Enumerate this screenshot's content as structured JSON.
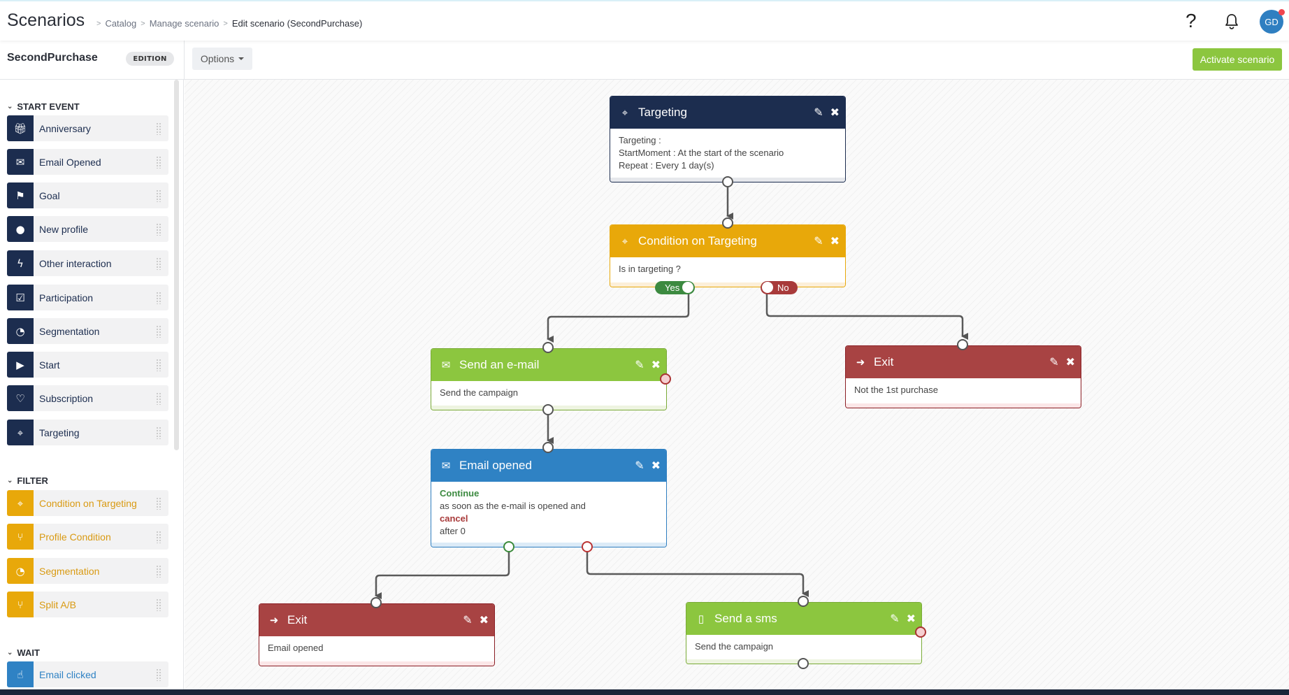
{
  "header": {
    "app_title": "Scenarios",
    "breadcrumb": [
      "Catalog",
      "Manage scenario",
      "Edit scenario (SecondPurchase)"
    ],
    "help_label": "?",
    "avatar_initials": "GD"
  },
  "subbar": {
    "scenario_name": "SecondPurchase",
    "status_badge": "EDITION",
    "options_label": "Options",
    "activate_label": "Activate scenario"
  },
  "sidebar": {
    "sections": [
      {
        "title": "START EVENT",
        "color": "#1c2d4f",
        "items": [
          {
            "label": "Anniversary",
            "icon": "gift-icon"
          },
          {
            "label": "Email Opened",
            "icon": "envelope-open-icon"
          },
          {
            "label": "Goal",
            "icon": "flag-icon"
          },
          {
            "label": "New profile",
            "icon": "user-icon"
          },
          {
            "label": "Other interaction",
            "icon": "bolt-icon"
          },
          {
            "label": "Participation",
            "icon": "checkbox-icon"
          },
          {
            "label": "Segmentation",
            "icon": "pie-chart-icon"
          },
          {
            "label": "Start",
            "icon": "play-icon"
          },
          {
            "label": "Subscription",
            "icon": "heart-icon"
          },
          {
            "label": "Targeting",
            "icon": "crosshair-icon"
          }
        ]
      },
      {
        "title": "FILTER",
        "color": "#e8a80a",
        "items": [
          {
            "label": "Condition on Targeting",
            "icon": "crosshair-icon"
          },
          {
            "label": "Profile Condition",
            "icon": "branch-icon"
          },
          {
            "label": "Segmentation",
            "icon": "pie-chart-icon"
          },
          {
            "label": "Split A/B",
            "icon": "branch-icon"
          }
        ]
      },
      {
        "title": "WAIT",
        "color": "#2f82c4",
        "items": [
          {
            "label": "Email clicked",
            "icon": "pointer-hand-icon"
          }
        ]
      }
    ]
  },
  "canvas": {
    "nodes": {
      "targeting": {
        "title": "Targeting",
        "icon": "crosshair-icon",
        "lines": [
          "Targeting :",
          "StartMoment : At the start of the scenario",
          "Repeat : Every 1 day(s)"
        ]
      },
      "condition": {
        "title": "Condition on Targeting",
        "icon": "crosshair-icon",
        "lines": [
          "Is in targeting ?"
        ],
        "yes_label": "Yes",
        "no_label": "No"
      },
      "send_email": {
        "title": "Send an e-mail",
        "icon": "envelope-icon",
        "lines": [
          "Send the campaign"
        ]
      },
      "exit_right": {
        "title": "Exit",
        "icon": "sign-out-icon",
        "lines": [
          "Not the 1st purchase"
        ]
      },
      "email_opened": {
        "title": "Email opened",
        "icon": "envelope-open-icon",
        "continue_label": "Continue",
        "continue_text": "as soon as the e-mail is opened and",
        "cancel_label": "cancel",
        "cancel_text": "after 0"
      },
      "exit_left": {
        "title": "Exit",
        "icon": "sign-out-icon",
        "lines": [
          "Email opened"
        ]
      },
      "send_sms": {
        "title": "Send a sms",
        "icon": "mobile-icon",
        "lines": [
          "Send the campaign"
        ]
      }
    }
  },
  "colors": {
    "navy": "#1c2d4f",
    "amber": "#e8a80a",
    "green": "#8cc63f",
    "blue": "#2f82c4",
    "red": "#a84343",
    "yes": "#3c8a40",
    "no": "#a83a3a"
  }
}
